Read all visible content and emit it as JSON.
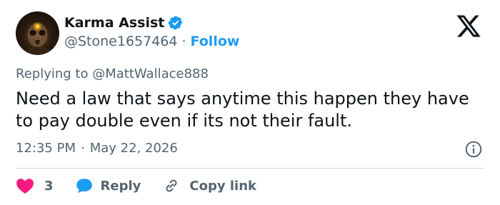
{
  "author": {
    "name": "Karma Assist",
    "handle": "@Stone1657464",
    "separator": "·",
    "follow_label": "Follow"
  },
  "reply_context": {
    "prefix": "Replying to",
    "mention": "@MattWallace888"
  },
  "tweet": {
    "text": "Need a law that says anytime this happen they have to pay double even if its not their fault.",
    "time": "12:35 PM",
    "date": "May 22, 2026",
    "separator": "·"
  },
  "actions": {
    "like_count": "3",
    "reply_label": "Reply",
    "copy_link_label": "Copy link"
  },
  "colors": {
    "accent": "#1d9bf0",
    "like": "#f91880",
    "secondary_text": "#536471",
    "divider": "#cfd9de"
  },
  "icons": [
    "verified-badge-icon",
    "x-logo-icon",
    "info-icon",
    "heart-icon",
    "reply-bubble-icon",
    "link-icon"
  ]
}
